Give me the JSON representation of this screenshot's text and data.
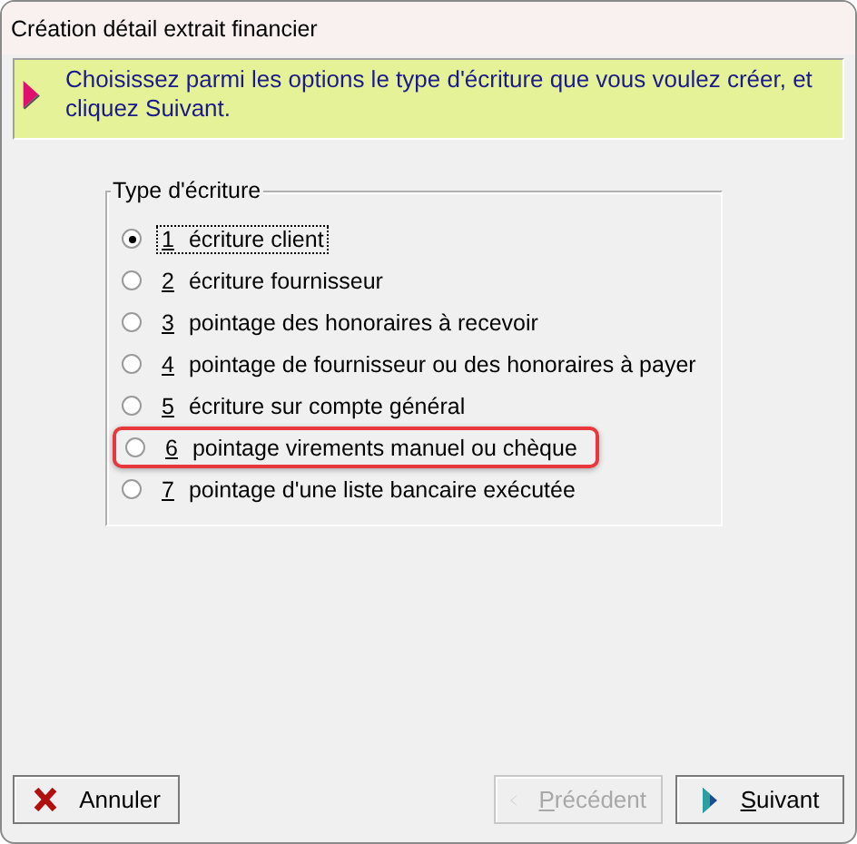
{
  "window": {
    "title": "Création détail extrait financier"
  },
  "banner": {
    "text": "Choisissez parmi les options le type d'écriture que vous voulez créer, et cliquez Suivant."
  },
  "group": {
    "title": "Type d'écriture",
    "options": [
      {
        "number": "1",
        "label": "écriture client",
        "selected": true,
        "highlighted": false
      },
      {
        "number": "2",
        "label": "écriture fournisseur",
        "selected": false,
        "highlighted": false
      },
      {
        "number": "3",
        "label": "pointage des honoraires à recevoir",
        "selected": false,
        "highlighted": false
      },
      {
        "number": "4",
        "label": "pointage de fournisseur ou des honoraires à payer",
        "selected": false,
        "highlighted": false
      },
      {
        "number": "5",
        "label": "écriture sur compte général",
        "selected": false,
        "highlighted": false
      },
      {
        "number": "6",
        "label": "pointage virements manuel ou chèque",
        "selected": false,
        "highlighted": true
      },
      {
        "number": "7",
        "label": "pointage d'une liste bancaire exécutée",
        "selected": false,
        "highlighted": false
      }
    ]
  },
  "buttons": [
    {
      "kind": "cancel",
      "label": "Annuler",
      "disabled": false,
      "underline_first": false
    },
    {
      "kind": "back",
      "label": "Précédent",
      "disabled": true,
      "underline_first": true
    },
    {
      "kind": "next",
      "label": "Suivant",
      "disabled": false,
      "underline_first": true
    }
  ]
}
